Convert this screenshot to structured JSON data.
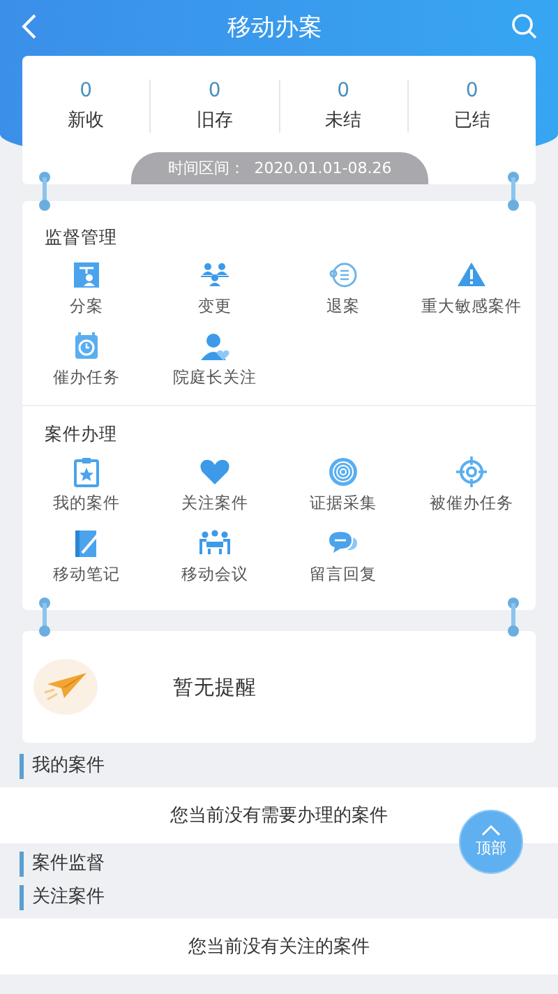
{
  "header": {
    "title": "移动办案"
  },
  "stats": [
    {
      "value": "0",
      "label": "新收"
    },
    {
      "value": "0",
      "label": "旧存"
    },
    {
      "value": "0",
      "label": "未结"
    },
    {
      "value": "0",
      "label": "已结"
    }
  ],
  "time_range": {
    "label": "时间区间：",
    "value": "2020.01.01-08.26"
  },
  "menu_sections": [
    {
      "title": "监督管理",
      "items": [
        "分案",
        "变更",
        "退案",
        "重大敏感案件",
        "催办任务",
        "院庭长关注"
      ]
    },
    {
      "title": "案件办理",
      "items": [
        "我的案件",
        "关注案件",
        "证据采集",
        "被催办任务",
        "移动笔记",
        "移动会议",
        "留言回复"
      ]
    }
  ],
  "reminder": {
    "text": "暂无提醒"
  },
  "case_sections": [
    {
      "title": "我的案件",
      "message": "您当前没有需要办理的案件"
    },
    {
      "title": "案件监督"
    },
    {
      "title": "关注案件",
      "message": "您当前没有关注的案件"
    }
  ],
  "back_to_top": {
    "label": "顶部"
  }
}
